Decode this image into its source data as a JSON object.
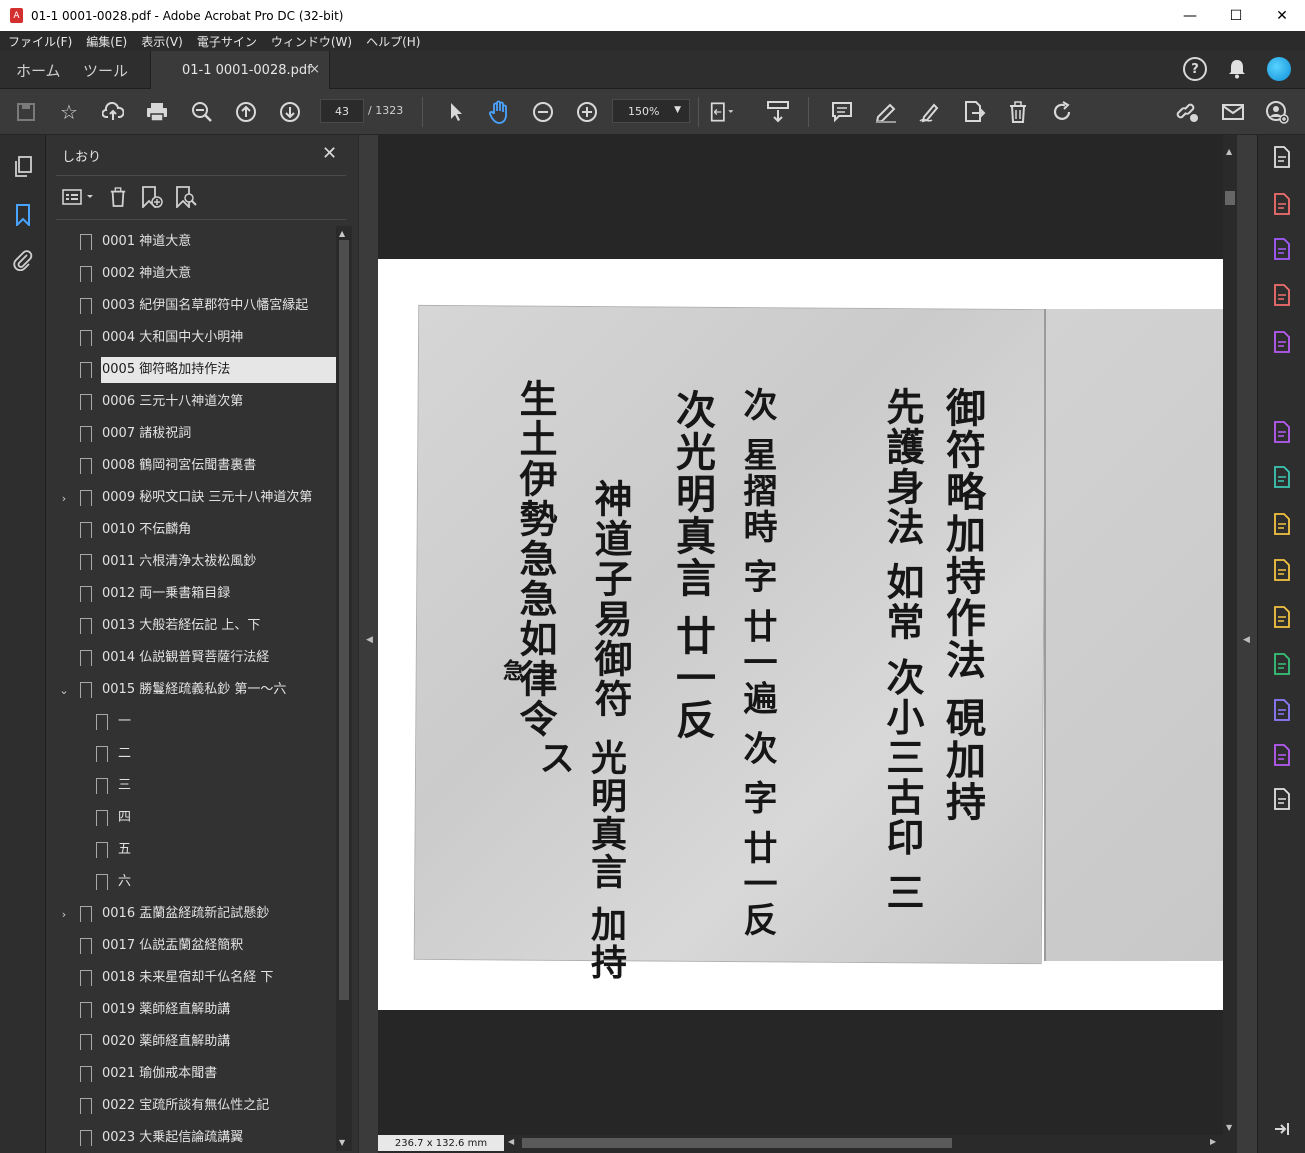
{
  "window": {
    "title": "01-1 0001-0028.pdf - Adobe Acrobat Pro DC (32-bit)",
    "minimize_glyph": "—",
    "maximize_glyph": "☐",
    "close_glyph": "✕"
  },
  "menu": [
    "ファイル(F)",
    "編集(E)",
    "表示(V)",
    "電子サイン",
    "ウィンドウ(W)",
    "ヘルプ(H)"
  ],
  "tabs": {
    "home": "ホーム",
    "tools": "ツール",
    "document": "01-1 0001-0028.pdf",
    "close_glyph": "×",
    "help_glyph": "?"
  },
  "toolbar": {
    "page_current": "43",
    "page_total": "/ 1323",
    "zoom": "150%",
    "icons": [
      "save-icon",
      "star-icon",
      "upload-icon",
      "print-icon",
      "zoom-out-search-icon",
      "page-up-icon",
      "page-down-icon",
      "select-arrow-icon",
      "hand-icon",
      "zoom-minus-icon",
      "zoom-plus-icon",
      "fit-page-icon",
      "scroll-mode-icon",
      "comment-icon",
      "highlight-icon",
      "sign-icon",
      "export-icon",
      "trash-icon",
      "rotate-icon",
      "share-link-icon",
      "mail-icon",
      "user-add-icon"
    ]
  },
  "bookmarks": {
    "title": "しおり",
    "close_glyph": "✕",
    "items": [
      {
        "label": "0001 神道大意",
        "level": 0,
        "expander": ""
      },
      {
        "label": "0002 神道大意",
        "level": 0,
        "expander": ""
      },
      {
        "label": "0003 紀伊国名草郡符中八幡宮縁起",
        "level": 0,
        "expander": ""
      },
      {
        "label": "0004 大和国中大小明神",
        "level": 0,
        "expander": ""
      },
      {
        "label": "0005 御符略加持作法",
        "level": 0,
        "expander": "",
        "selected": true
      },
      {
        "label": "0006 三元十八神道次第",
        "level": 0,
        "expander": ""
      },
      {
        "label": "0007 諸秡祝詞",
        "level": 0,
        "expander": ""
      },
      {
        "label": "0008 鶴岡祠宮伝聞書裏書",
        "level": 0,
        "expander": ""
      },
      {
        "label": "0009 秘呎文口訣 三元十八神道次第",
        "level": 0,
        "expander": "›"
      },
      {
        "label": "0010 不伝麟角",
        "level": 0,
        "expander": ""
      },
      {
        "label": "0011 六根清浄太祓松風鈔",
        "level": 0,
        "expander": ""
      },
      {
        "label": "0012 両一乗書箱目録",
        "level": 0,
        "expander": ""
      },
      {
        "label": "0013 大般若経伝記 上、下",
        "level": 0,
        "expander": ""
      },
      {
        "label": "0014 仏説観普賢菩薩行法経",
        "level": 0,
        "expander": ""
      },
      {
        "label": "0015 勝鬘経疏義私鈔 第一～六",
        "level": 0,
        "expander": "⌄"
      },
      {
        "label": "一",
        "level": 1,
        "expander": ""
      },
      {
        "label": "二",
        "level": 1,
        "expander": ""
      },
      {
        "label": "三",
        "level": 1,
        "expander": ""
      },
      {
        "label": "四",
        "level": 1,
        "expander": ""
      },
      {
        "label": "五",
        "level": 1,
        "expander": ""
      },
      {
        "label": "六",
        "level": 1,
        "expander": ""
      },
      {
        "label": "0016 盂蘭盆経疏新記試懸鈔",
        "level": 0,
        "expander": "›"
      },
      {
        "label": "0017 仏説盂蘭盆経簡釈",
        "level": 0,
        "expander": ""
      },
      {
        "label": "0018 未来星宿却千仏名経 下",
        "level": 0,
        "expander": ""
      },
      {
        "label": "0019 薬師経直解助講",
        "level": 0,
        "expander": ""
      },
      {
        "label": "0020 薬師経直解助講",
        "level": 0,
        "expander": ""
      },
      {
        "label": "0021 瑜伽戒本聞書",
        "level": 0,
        "expander": ""
      },
      {
        "label": "0022 宝疏所談有無仏性之記",
        "level": 0,
        "expander": ""
      },
      {
        "label": "0023 大乗起信論疏講翼",
        "level": 0,
        "expander": ""
      }
    ]
  },
  "document": {
    "columns": [
      "御符略加持作法 硯加持",
      "先護身法 如常 次小三古印 三",
      "次 星摺時 字 廿一遍 次 字 廿一反",
      "次光明真言 廿一反",
      "神道子易御符",
      "生土伊勢急急如律令",
      "光明真言 加持ス",
      "急"
    ],
    "dimensions": "236.7 x 132.6 mm"
  },
  "colors": {
    "accent": "#4aa4ff",
    "background": "#323232",
    "toolbar": "#3a3a3a"
  },
  "right_tools": [
    {
      "icon": "enhance-icon",
      "color": "#e2e2e2"
    },
    {
      "icon": "create-pdf-icon",
      "color": "#f26f6f"
    },
    {
      "icon": "combine-icon",
      "color": "#a35cff"
    },
    {
      "icon": "organize-icon",
      "color": "#f26f6f"
    },
    {
      "icon": "edit-pdf-icon",
      "color": "#b85cf5"
    },
    {
      "icon": "fill-sign-icon",
      "color": "#b85cf5"
    },
    {
      "icon": "export-pdf-icon",
      "color": "#3cc7b2"
    },
    {
      "icon": "compare-icon",
      "color": "#f5c342"
    },
    {
      "icon": "scan-icon",
      "color": "#f5c342"
    },
    {
      "icon": "comment-tool-icon",
      "color": "#f5c342"
    },
    {
      "icon": "print-production-icon",
      "color": "#37c37a"
    },
    {
      "icon": "protect-icon",
      "color": "#8d7cff"
    },
    {
      "icon": "request-sign-icon",
      "color": "#b85cf5"
    },
    {
      "icon": "more-tools-icon",
      "color": "#e2e2e2"
    }
  ]
}
